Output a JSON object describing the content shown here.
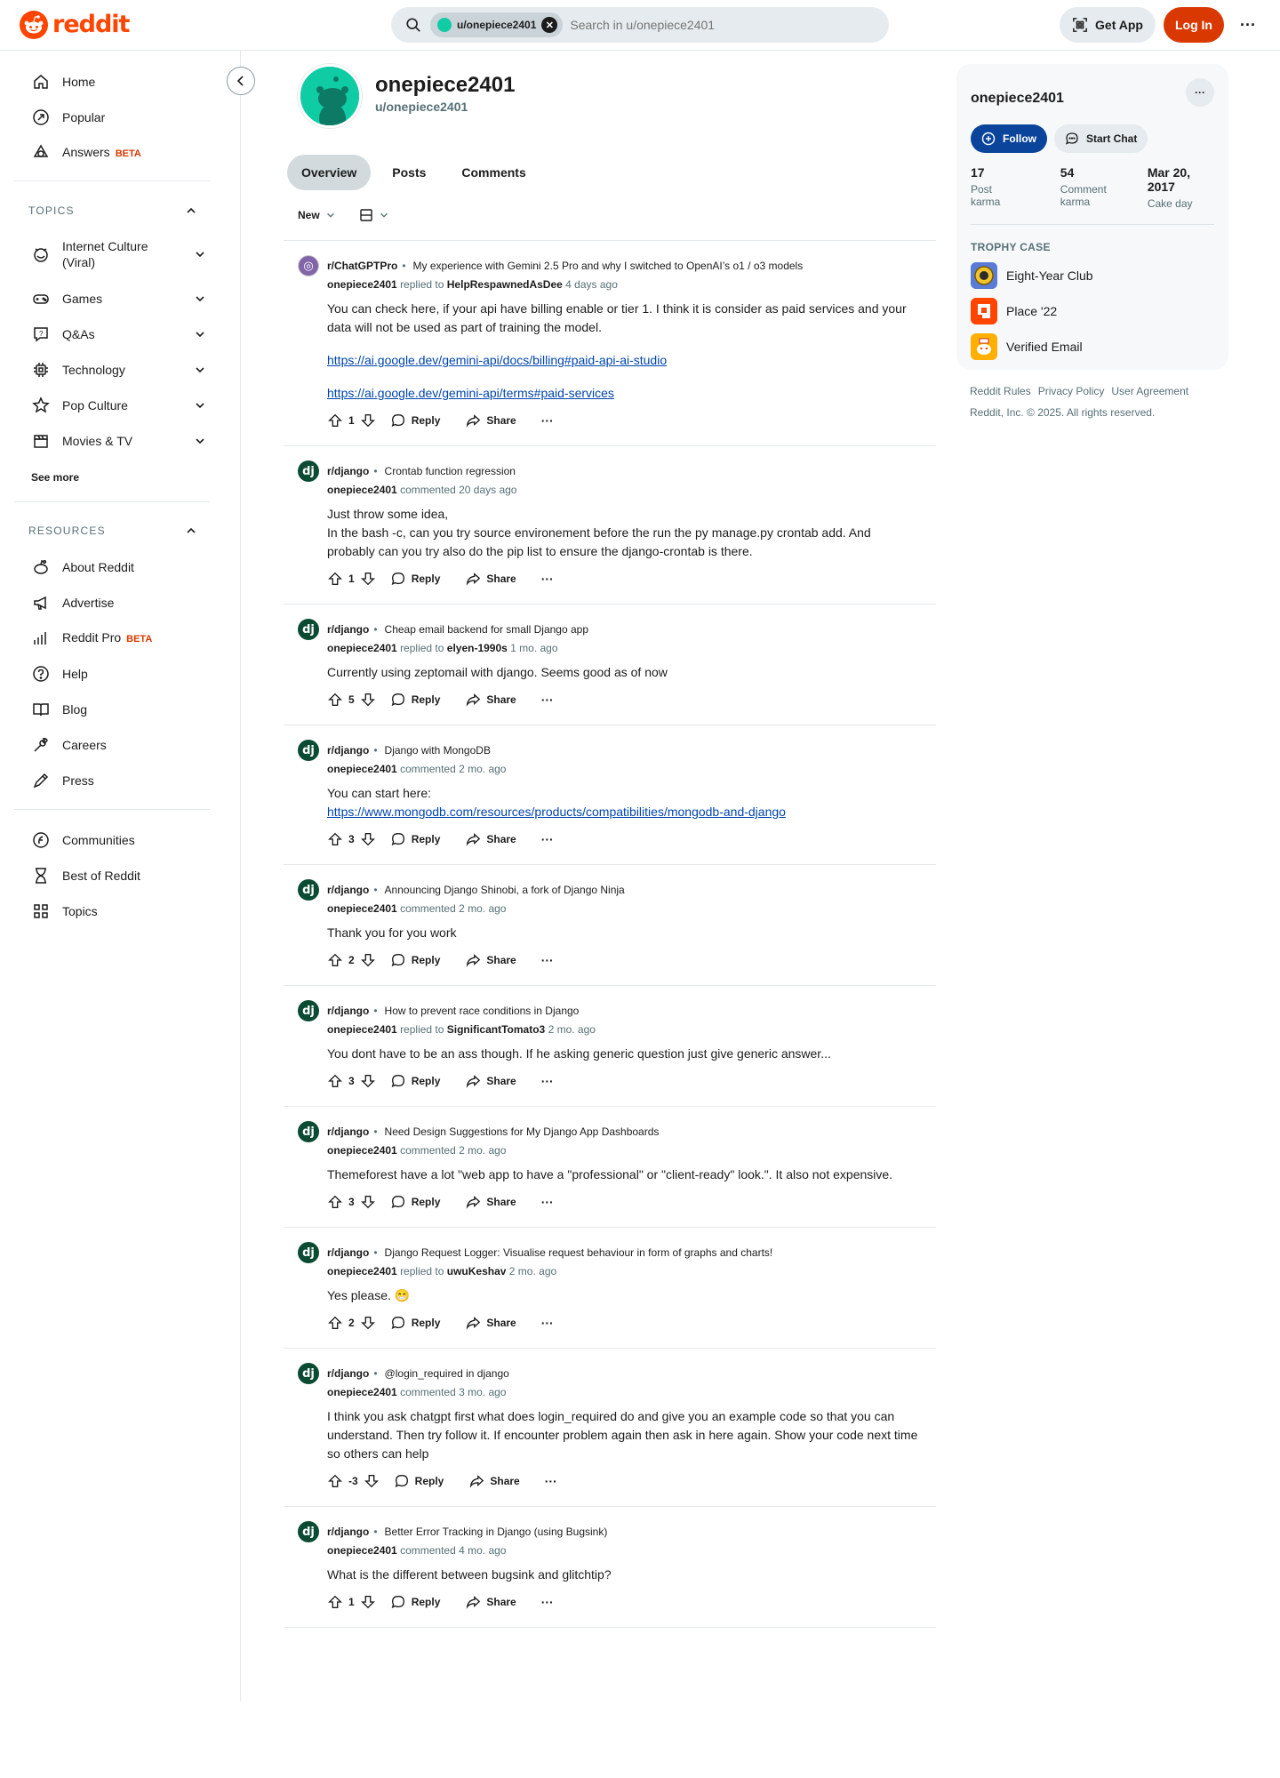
{
  "header": {
    "logo_text": "reddit",
    "search_chip": "u/onepiece2401",
    "search_placeholder": "Search in u/onepiece2401",
    "get_app": "Get App",
    "login": "Log In"
  },
  "sidebar": {
    "main": [
      {
        "label": "Home",
        "icon": "home-icon"
      },
      {
        "label": "Popular",
        "icon": "popular-icon"
      },
      {
        "label": "Answers",
        "icon": "answers-icon",
        "badge": "BETA"
      }
    ],
    "topics_header": "TOPICS",
    "topics": [
      {
        "label": "Internet Culture (Viral)",
        "icon": "internet-culture-icon"
      },
      {
        "label": "Games",
        "icon": "gamepad-icon"
      },
      {
        "label": "Q&As",
        "icon": "qa-icon"
      },
      {
        "label": "Technology",
        "icon": "chip-icon"
      },
      {
        "label": "Pop Culture",
        "icon": "star-icon"
      },
      {
        "label": "Movies & TV",
        "icon": "clapper-icon"
      }
    ],
    "see_more": "See more",
    "resources_header": "RESOURCES",
    "resources": [
      {
        "label": "About Reddit",
        "icon": "reddit-alien-icon"
      },
      {
        "label": "Advertise",
        "icon": "megaphone-icon"
      },
      {
        "label": "Reddit Pro",
        "icon": "bar-chart-icon",
        "badge": "BETA"
      },
      {
        "label": "Help",
        "icon": "help-icon"
      },
      {
        "label": "Blog",
        "icon": "book-icon"
      },
      {
        "label": "Careers",
        "icon": "wrench-icon"
      },
      {
        "label": "Press",
        "icon": "pen-icon"
      }
    ],
    "bottom": [
      {
        "label": "Communities",
        "icon": "communities-icon"
      },
      {
        "label": "Best of Reddit",
        "icon": "hourglass-icon"
      },
      {
        "label": "Topics",
        "icon": "grid-icon"
      }
    ]
  },
  "profile": {
    "display_name": "onepiece2401",
    "username": "u/onepiece2401",
    "tabs": [
      "Overview",
      "Posts",
      "Comments"
    ],
    "sort": "New"
  },
  "comments": [
    {
      "sub": "r/ChatGPTPro",
      "sub_icon": "gpt",
      "title": "My experience with Gemini 2.5 Pro and why I switched to OpenAI’s o1 / o3 models",
      "author": "onepiece2401",
      "verb": "replied to",
      "target": "HelpRespawnedAsDee",
      "time": "4 days ago",
      "body": [
        "You can check here, if your api have billing enable or tier 1. I think it is consider as paid services and your data will not be used as part of training the model.",
        {
          "link": "https://ai.google.dev/gemini-api/docs/billing#paid-api-ai-studio"
        },
        {
          "link": "https://ai.google.dev/gemini-api/terms#paid-services"
        }
      ],
      "votes": "1"
    },
    {
      "sub": "r/django",
      "sub_icon": "dj",
      "title": "Crontab function regression",
      "author": "onepiece2401",
      "verb": "commented",
      "target": "",
      "time": "20 days ago",
      "body": [
        "Just throw some idea,\nIn the bash -c, can you try source environement before the run the py manage.py crontab add. And probably can you try also do the pip list to ensure the django-crontab is there."
      ],
      "votes": "1"
    },
    {
      "sub": "r/django",
      "sub_icon": "dj",
      "title": "Cheap email backend for small Django app",
      "author": "onepiece2401",
      "verb": "replied to",
      "target": "elyen-1990s",
      "time": "1 mo. ago",
      "body": [
        "Currently using zeptomail with django. Seems good as of now"
      ],
      "votes": "5"
    },
    {
      "sub": "r/django",
      "sub_icon": "dj",
      "title": "Django with MongoDB",
      "author": "onepiece2401",
      "verb": "commented",
      "target": "",
      "time": "2 mo. ago",
      "body": [
        {
          "text": "You can start here:",
          "link": "https://www.mongodb.com/resources/products/compatibilities/mongodb-and-django"
        }
      ],
      "votes": "3"
    },
    {
      "sub": "r/django",
      "sub_icon": "dj",
      "title": "Announcing Django Shinobi, a fork of Django Ninja",
      "author": "onepiece2401",
      "verb": "commented",
      "target": "",
      "time": "2 mo. ago",
      "body": [
        "Thank you for you work"
      ],
      "votes": "2"
    },
    {
      "sub": "r/django",
      "sub_icon": "dj",
      "title": "How to prevent race conditions in Django",
      "author": "onepiece2401",
      "verb": "replied to",
      "target": "SignificantTomato3",
      "time": "2 mo. ago",
      "body": [
        "You dont have to be an ass though. If he asking generic question just give generic answer..."
      ],
      "votes": "3"
    },
    {
      "sub": "r/django",
      "sub_icon": "dj",
      "title": "Need Design Suggestions for My Django App Dashboards",
      "author": "onepiece2401",
      "verb": "commented",
      "target": "",
      "time": "2 mo. ago",
      "body": [
        "Themeforest have a lot \"web app to have a \"professional\" or \"client-ready\" look.\". It also not expensive."
      ],
      "votes": "3"
    },
    {
      "sub": "r/django",
      "sub_icon": "dj",
      "title": "Django Request Logger: Visualise request behaviour in form of graphs and charts!",
      "author": "onepiece2401",
      "verb": "replied to",
      "target": "uwuKeshav",
      "time": "2 mo. ago",
      "body": [
        "Yes please. 😁"
      ],
      "votes": "2"
    },
    {
      "sub": "r/django",
      "sub_icon": "dj",
      "title": "@login_required in django",
      "author": "onepiece2401",
      "verb": "commented",
      "target": "",
      "time": "3 mo. ago",
      "body": [
        "I think you ask chatgpt first what does login_required do and give you an example code so that you can understand. Then try follow it. If encounter problem again then ask in here again. Show your code next time so others can help"
      ],
      "votes": "-3"
    },
    {
      "sub": "r/django",
      "sub_icon": "dj",
      "title": "Better Error Tracking in Django (using Bugsink)",
      "author": "onepiece2401",
      "verb": "commented",
      "target": "",
      "time": "4 mo. ago",
      "body": [
        "What is the different between bugsink and glitchtip?"
      ],
      "votes": "1"
    }
  ],
  "actions": {
    "reply": "Reply",
    "share": "Share",
    "more": "···"
  },
  "right_card": {
    "name": "onepiece2401",
    "more": "···",
    "follow": "Follow",
    "chat": "Start Chat",
    "stats": [
      {
        "value": "17",
        "label": "Post karma"
      },
      {
        "value": "54",
        "label": "Comment karma"
      },
      {
        "value": "Mar 20, 2017",
        "label": "Cake day"
      }
    ],
    "trophy_header": "TROPHY CASE",
    "trophies": [
      {
        "label": "Eight-Year Club",
        "icon": "eight-year-club-icon"
      },
      {
        "label": "Place '22",
        "icon": "place-22-icon"
      },
      {
        "label": "Verified Email",
        "icon": "verified-email-icon"
      }
    ]
  },
  "footer": {
    "links": [
      "Reddit Rules",
      "Privacy Policy",
      "User Agreement"
    ],
    "copyright": "Reddit, Inc. © 2025. All rights reserved."
  },
  "colors": {
    "brand": "#ff4500",
    "login": "#d93900",
    "follow": "#0a449b",
    "link": "#0045ac",
    "django": "#0c4b33",
    "avatar": "#0fcca5"
  }
}
